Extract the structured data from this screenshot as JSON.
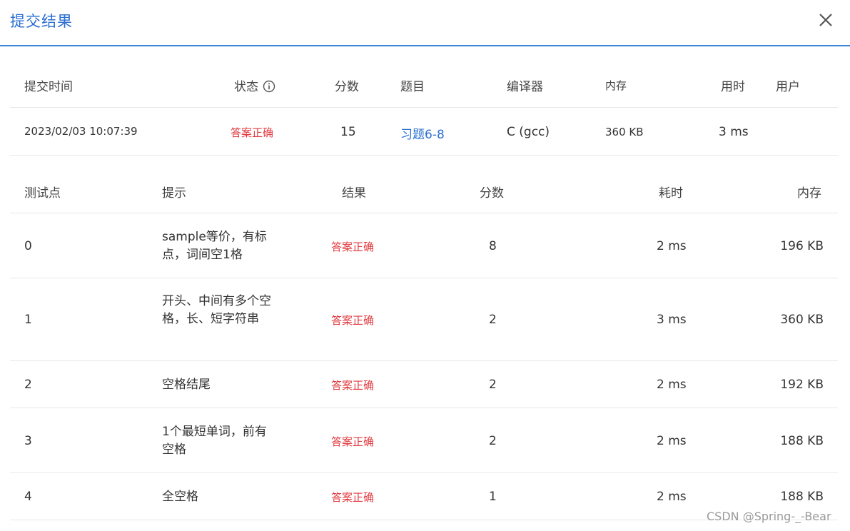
{
  "dialog": {
    "title": "提交结果",
    "close_icon": "close-icon"
  },
  "submission": {
    "headers": {
      "time": "提交时间",
      "status": "状态",
      "score": "分数",
      "problem": "题目",
      "compiler": "编译器",
      "memory": "内存",
      "duration": "用时",
      "user": "用户"
    },
    "row": {
      "time": "2023/02/03 10:07:39",
      "status": "答案正确",
      "score": "15",
      "problem": "习题6-8",
      "compiler": "C (gcc)",
      "memory": "360 KB",
      "duration": "3 ms",
      "user": ""
    }
  },
  "tests": {
    "headers": {
      "point": "测试点",
      "hint": "提示",
      "result": "结果",
      "score": "分数",
      "time": "耗时",
      "memory": "内存"
    },
    "rows": [
      {
        "point": "0",
        "hint": "sample等价，有标点，词间空1格",
        "result": "答案正确",
        "score": "8",
        "time": "2 ms",
        "memory": "196 KB"
      },
      {
        "point": "1",
        "hint": "开头、中间有多个空格，长、短字符串",
        "result": "答案正确",
        "score": "2",
        "time": "3 ms",
        "memory": "360 KB"
      },
      {
        "point": "2",
        "hint": "空格结尾",
        "result": "答案正确",
        "score": "2",
        "time": "2 ms",
        "memory": "192 KB"
      },
      {
        "point": "3",
        "hint": "1个最短单词，前有空格",
        "result": "答案正确",
        "score": "2",
        "time": "2 ms",
        "memory": "188 KB"
      },
      {
        "point": "4",
        "hint": "全空格",
        "result": "答案正确",
        "score": "1",
        "time": "2 ms",
        "memory": "188 KB"
      }
    ]
  },
  "watermark": "CSDN @Spring-_-Bear",
  "colors": {
    "accent": "#2b6fd1",
    "success_text": "#e0393e",
    "divider": "#e8e8e8"
  }
}
